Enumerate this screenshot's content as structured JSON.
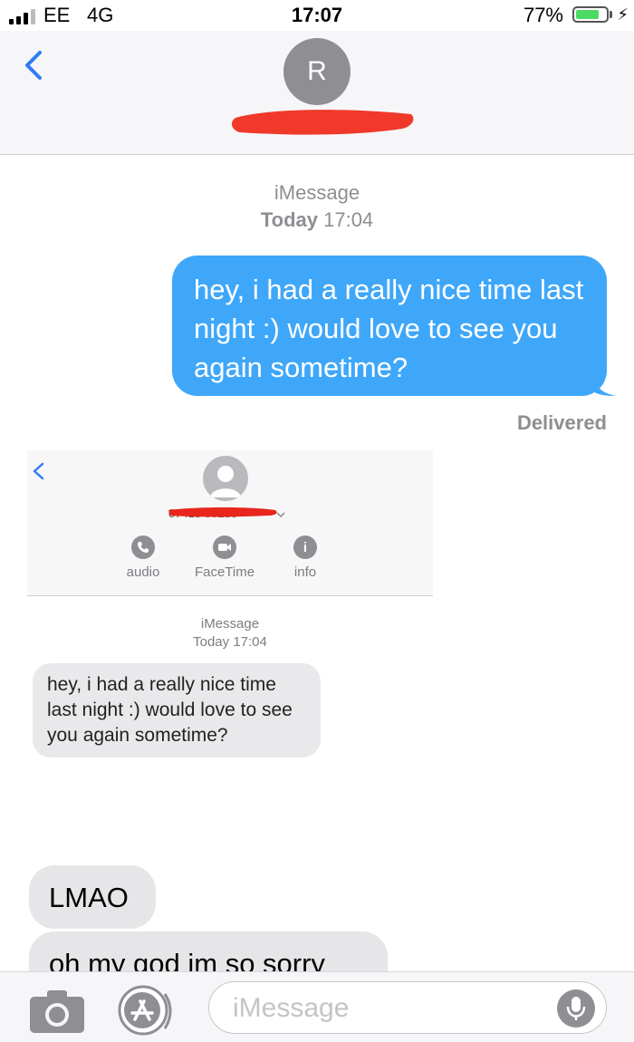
{
  "status_bar": {
    "carrier": "EE",
    "network": "4G",
    "time": "17:07",
    "battery_percent_label": "77%",
    "battery_level": 0.77
  },
  "header": {
    "contact_initial": "R",
    "back_icon": "chevron-left-icon"
  },
  "conversation": {
    "service_label": "iMessage",
    "timestamp_day": "Today",
    "timestamp_time": "17:04",
    "sent_message": "hey, i had a really nice time last night :) would love to see you again sometime?",
    "delivery_status": "Delivered"
  },
  "embedded_screenshot": {
    "contact_number": "07415 00136",
    "actions": [
      {
        "label": "audio",
        "icon": "phone-icon"
      },
      {
        "label": "FaceTime",
        "icon": "video-icon"
      },
      {
        "label": "info",
        "icon": "info-icon"
      }
    ],
    "service_label": "iMessage",
    "timestamp": "Today 17:04",
    "message": "hey, i had a really nice time last night :) would love to see you again sometime?"
  },
  "received_messages": [
    "LMAO",
    "oh my god im so sorry"
  ],
  "input_bar": {
    "placeholder": "iMessage",
    "camera_icon": "camera-icon",
    "apps_icon": "app-store-icon",
    "mic_icon": "microphone-icon"
  },
  "colors": {
    "sent_bubble": "#3fa7f9",
    "received_bubble": "#e6e6e9",
    "accent_blue": "#2f7cf6",
    "redaction_red": "#f0392b"
  }
}
